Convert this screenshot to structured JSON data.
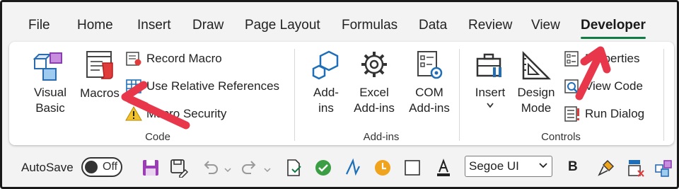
{
  "tabs": [
    "File",
    "Home",
    "Insert",
    "Draw",
    "Page Layout",
    "Formulas",
    "Data",
    "Review",
    "View",
    "Developer"
  ],
  "active_tab": "Developer",
  "colors": {
    "accent": "#107c41",
    "arrow": "#e8374a",
    "icon_blue": "#1e6fb8",
    "macro_red": "#e03c3c"
  },
  "groups": {
    "code": {
      "label": "Code",
      "visual_basic": {
        "label_line1": "Visual",
        "label_line2": "Basic",
        "icon": "visual-basic-icon"
      },
      "macros": {
        "label": "Macros",
        "icon": "macros-icon"
      },
      "record_macro": {
        "label": "Record Macro",
        "icon": "record-macro-icon"
      },
      "relative_refs": {
        "label": "Use Relative References",
        "icon": "table-grid-icon"
      },
      "macro_security": {
        "label": "Macro Security",
        "icon": "warning-icon"
      }
    },
    "addins": {
      "label": "Add-ins",
      "addins_btn": {
        "label_line1": "Add-",
        "label_line2": "ins",
        "icon": "hexagon-addin-icon"
      },
      "excel_addins": {
        "label_line1": "Excel",
        "label_line2": "Add-ins",
        "icon": "gear-icon"
      },
      "com_addins": {
        "label_line1": "COM",
        "label_line2": "Add-ins",
        "icon": "com-addin-icon"
      }
    },
    "controls": {
      "label": "Controls",
      "insert": {
        "label": "Insert",
        "icon": "toolbox-icon"
      },
      "design_mode": {
        "label_line1": "Design",
        "label_line2": "Mode",
        "icon": "design-mode-icon"
      },
      "properties": {
        "label": "Properties",
        "icon": "properties-icon"
      },
      "view_code": {
        "label": "View Code",
        "icon": "view-code-icon"
      },
      "run_dialog": {
        "label": "Run Dialog",
        "icon": "run-dialog-icon"
      }
    }
  },
  "qat": {
    "autosave_label": "AutoSave",
    "autosave_state": "Off",
    "font_name": "Segoe UI",
    "bold_label": "B"
  }
}
